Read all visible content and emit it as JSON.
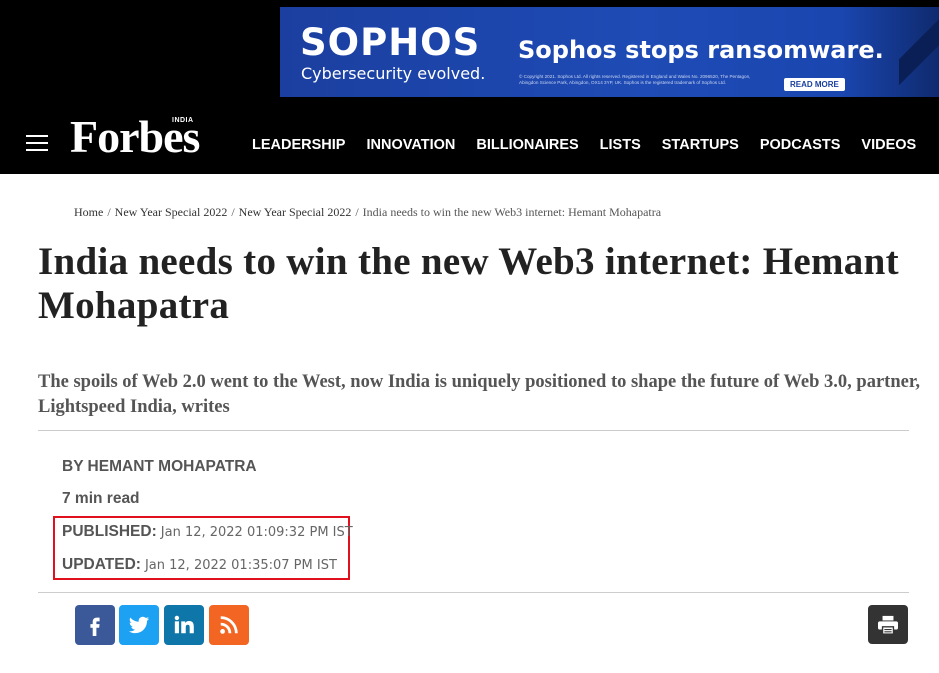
{
  "ad": {
    "brand": "SOPHOS",
    "tagline": "Cybersecurity evolved.",
    "headline": "Sophos stops ransomware.",
    "fine_print": "© Copyright 2021. Sophos Ltd. All rights reserved. Registered in England and Wales No. 2096520, The Pentagon, Abingdon Science Park, Abingdon, OX14 3YP, UK. Sophos is the registered trademark of Sophos Ltd.",
    "cta": "READ MORE"
  },
  "header": {
    "logo": "Forbes",
    "logo_edition": "INDIA",
    "nav": [
      "LEADERSHIP",
      "INNOVATION",
      "BILLIONAIRES",
      "LISTS",
      "STARTUPS",
      "PODCASTS",
      "VIDEOS"
    ]
  },
  "breadcrumb": {
    "home": "Home",
    "level1": "New Year Special 2022",
    "level2": "New Year Special 2022",
    "current": "India needs to win the new Web3 internet: Hemant Mohapatra",
    "separator": "/"
  },
  "article": {
    "title": "India needs to win the new Web3 internet: Hemant Mohapatra",
    "subtitle": "The spoils of Web 2.0 went to the West, now India is uniquely positioned to shape the future of Web 3.0, partner, Lightspeed India, writes",
    "byline": "BY HEMANT MOHAPATRA",
    "read_time": "7 min read",
    "published_label": "PUBLISHED:",
    "published_value": "Jan 12, 2022 01:09:32 PM IST",
    "updated_label": "UPDATED:",
    "updated_value": "Jan 12, 2022 01:35:07 PM IST"
  },
  "share": {
    "icons": [
      "facebook-icon",
      "twitter-icon",
      "linkedin-icon",
      "rss-icon",
      "print-icon"
    ]
  },
  "colors": {
    "header_bg": "#000000",
    "ad_bg": "#1e4bb5",
    "highlight_box": "#e0101e",
    "facebook": "#3b5998",
    "twitter": "#1da1f2",
    "linkedin": "#0e76a8",
    "rss": "#f26522",
    "print": "#333333"
  }
}
